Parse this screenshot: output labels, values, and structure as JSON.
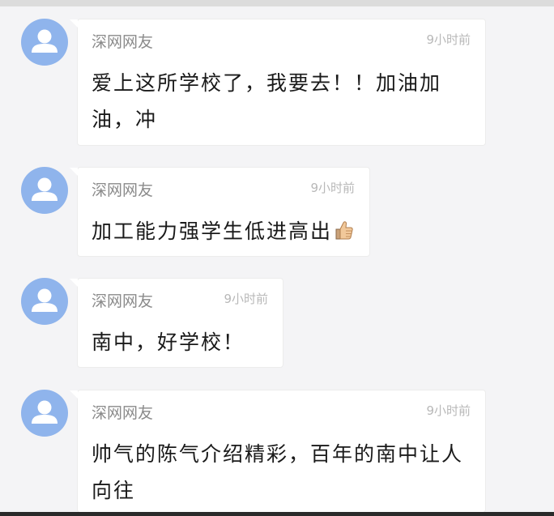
{
  "comments": [
    {
      "username": "深网网友",
      "time": "9小时前",
      "text": "爱上这所学校了，我要去！！加油加油，冲"
    },
    {
      "username": "深网网友",
      "time": "9小时前",
      "text": "加工能力强学生低进高出",
      "emoji": "thumbs-up-icon"
    },
    {
      "username": "深网网友",
      "time": "9小时前",
      "text": "南中，好学校！"
    },
    {
      "username": "深网网友",
      "time": "9小时前",
      "text": "帅气的陈气介绍精彩，百年的南中让人向往"
    }
  ],
  "colors": {
    "avatar_bg": "#8fb4ec",
    "page_bg": "#f4f4f6",
    "username": "#8a8a8a",
    "time": "#b8b8b8"
  }
}
